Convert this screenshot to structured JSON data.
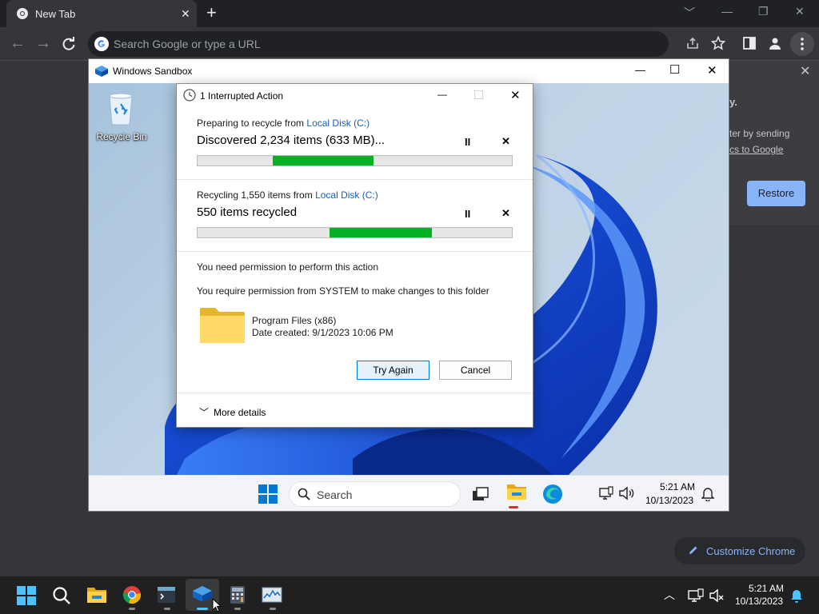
{
  "chrome": {
    "tab_title": "New Tab",
    "tab_close_glyph": "✕",
    "new_tab_glyph": "+",
    "window_controls": [
      "﹀",
      "—",
      "❐",
      "✕"
    ],
    "back_glyph": "←",
    "forward_glyph": "→",
    "omnibox_placeholder": "Search Google or type a URL",
    "ntp_side_text_1": "y.",
    "ntp_side_text_2": "ter by sending",
    "ntp_side_text_3": "cs to Google",
    "ntp_close_glyph": "✕",
    "restore_label": "Restore",
    "customize_label": "Customize Chrome"
  },
  "sandbox": {
    "title": "Windows Sandbox",
    "minimize_glyph": "—",
    "maximize_glyph": "☐",
    "close_glyph": "✕",
    "recycle_bin_label": "Recycle Bin",
    "search_label": "Search",
    "clock_time": "5:21 AM",
    "clock_date": "10/13/2023"
  },
  "dialog": {
    "title": "1 Interrupted Action",
    "minimize_glyph": "—",
    "maximize_glyph": "☐",
    "close_glyph": "✕",
    "op1_prefix": "Preparing to recycle from ",
    "op1_link": "Local Disk (C:)",
    "op1_status": "Discovered 2,234 items (633 MB)...",
    "op1_progress_start": 0.24,
    "op1_progress_end": 0.56,
    "op2_prefix": "Recycling 1,550 items from ",
    "op2_link": "Local Disk (C:)",
    "op2_status": "550 items recycled",
    "op2_progress_start": 0.42,
    "op2_progress_end": 0.745,
    "pause_glyph": "II",
    "stop_glyph": "✕",
    "permission_heading": "You need permission to perform this action",
    "permission_detail": "You require permission from SYSTEM to make changes to this folder",
    "folder_name": "Program Files (x86)",
    "folder_date": "Date created: 9/1/2023 10:06 PM",
    "try_again_label": "Try Again",
    "cancel_label": "Cancel",
    "more_details_glyph": "﹀",
    "more_details_label": "More details"
  },
  "host_taskbar": {
    "clock_time": "5:21 AM",
    "clock_date": "10/13/2023",
    "tray_chevron": "︿"
  }
}
